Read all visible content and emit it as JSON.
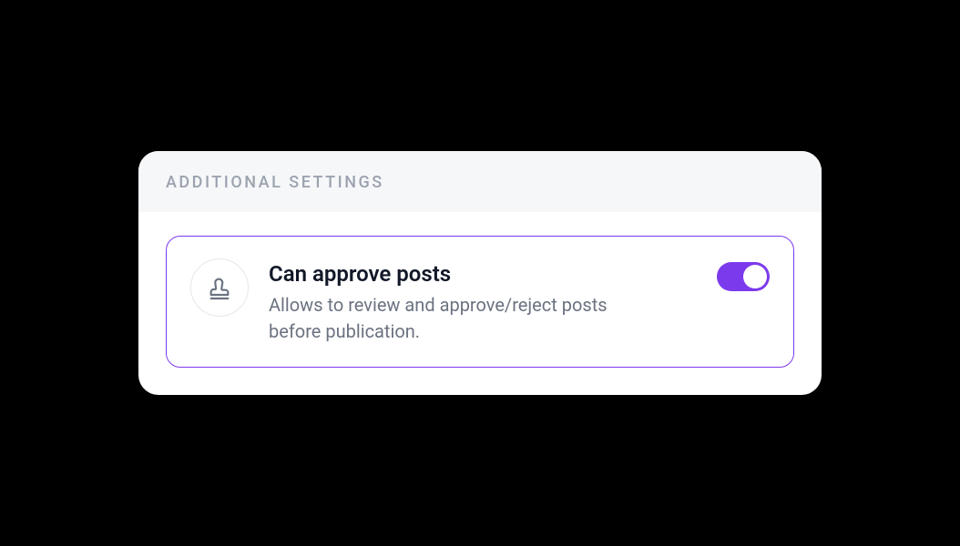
{
  "header": {
    "title": "ADDITIONAL SETTINGS"
  },
  "settings": {
    "approve_posts": {
      "title": "Can approve posts",
      "description": "Allows to review and approve/reject posts before publication.",
      "enabled": true,
      "icon": "stamp-icon"
    }
  },
  "colors": {
    "accent": "#7c3aed"
  }
}
